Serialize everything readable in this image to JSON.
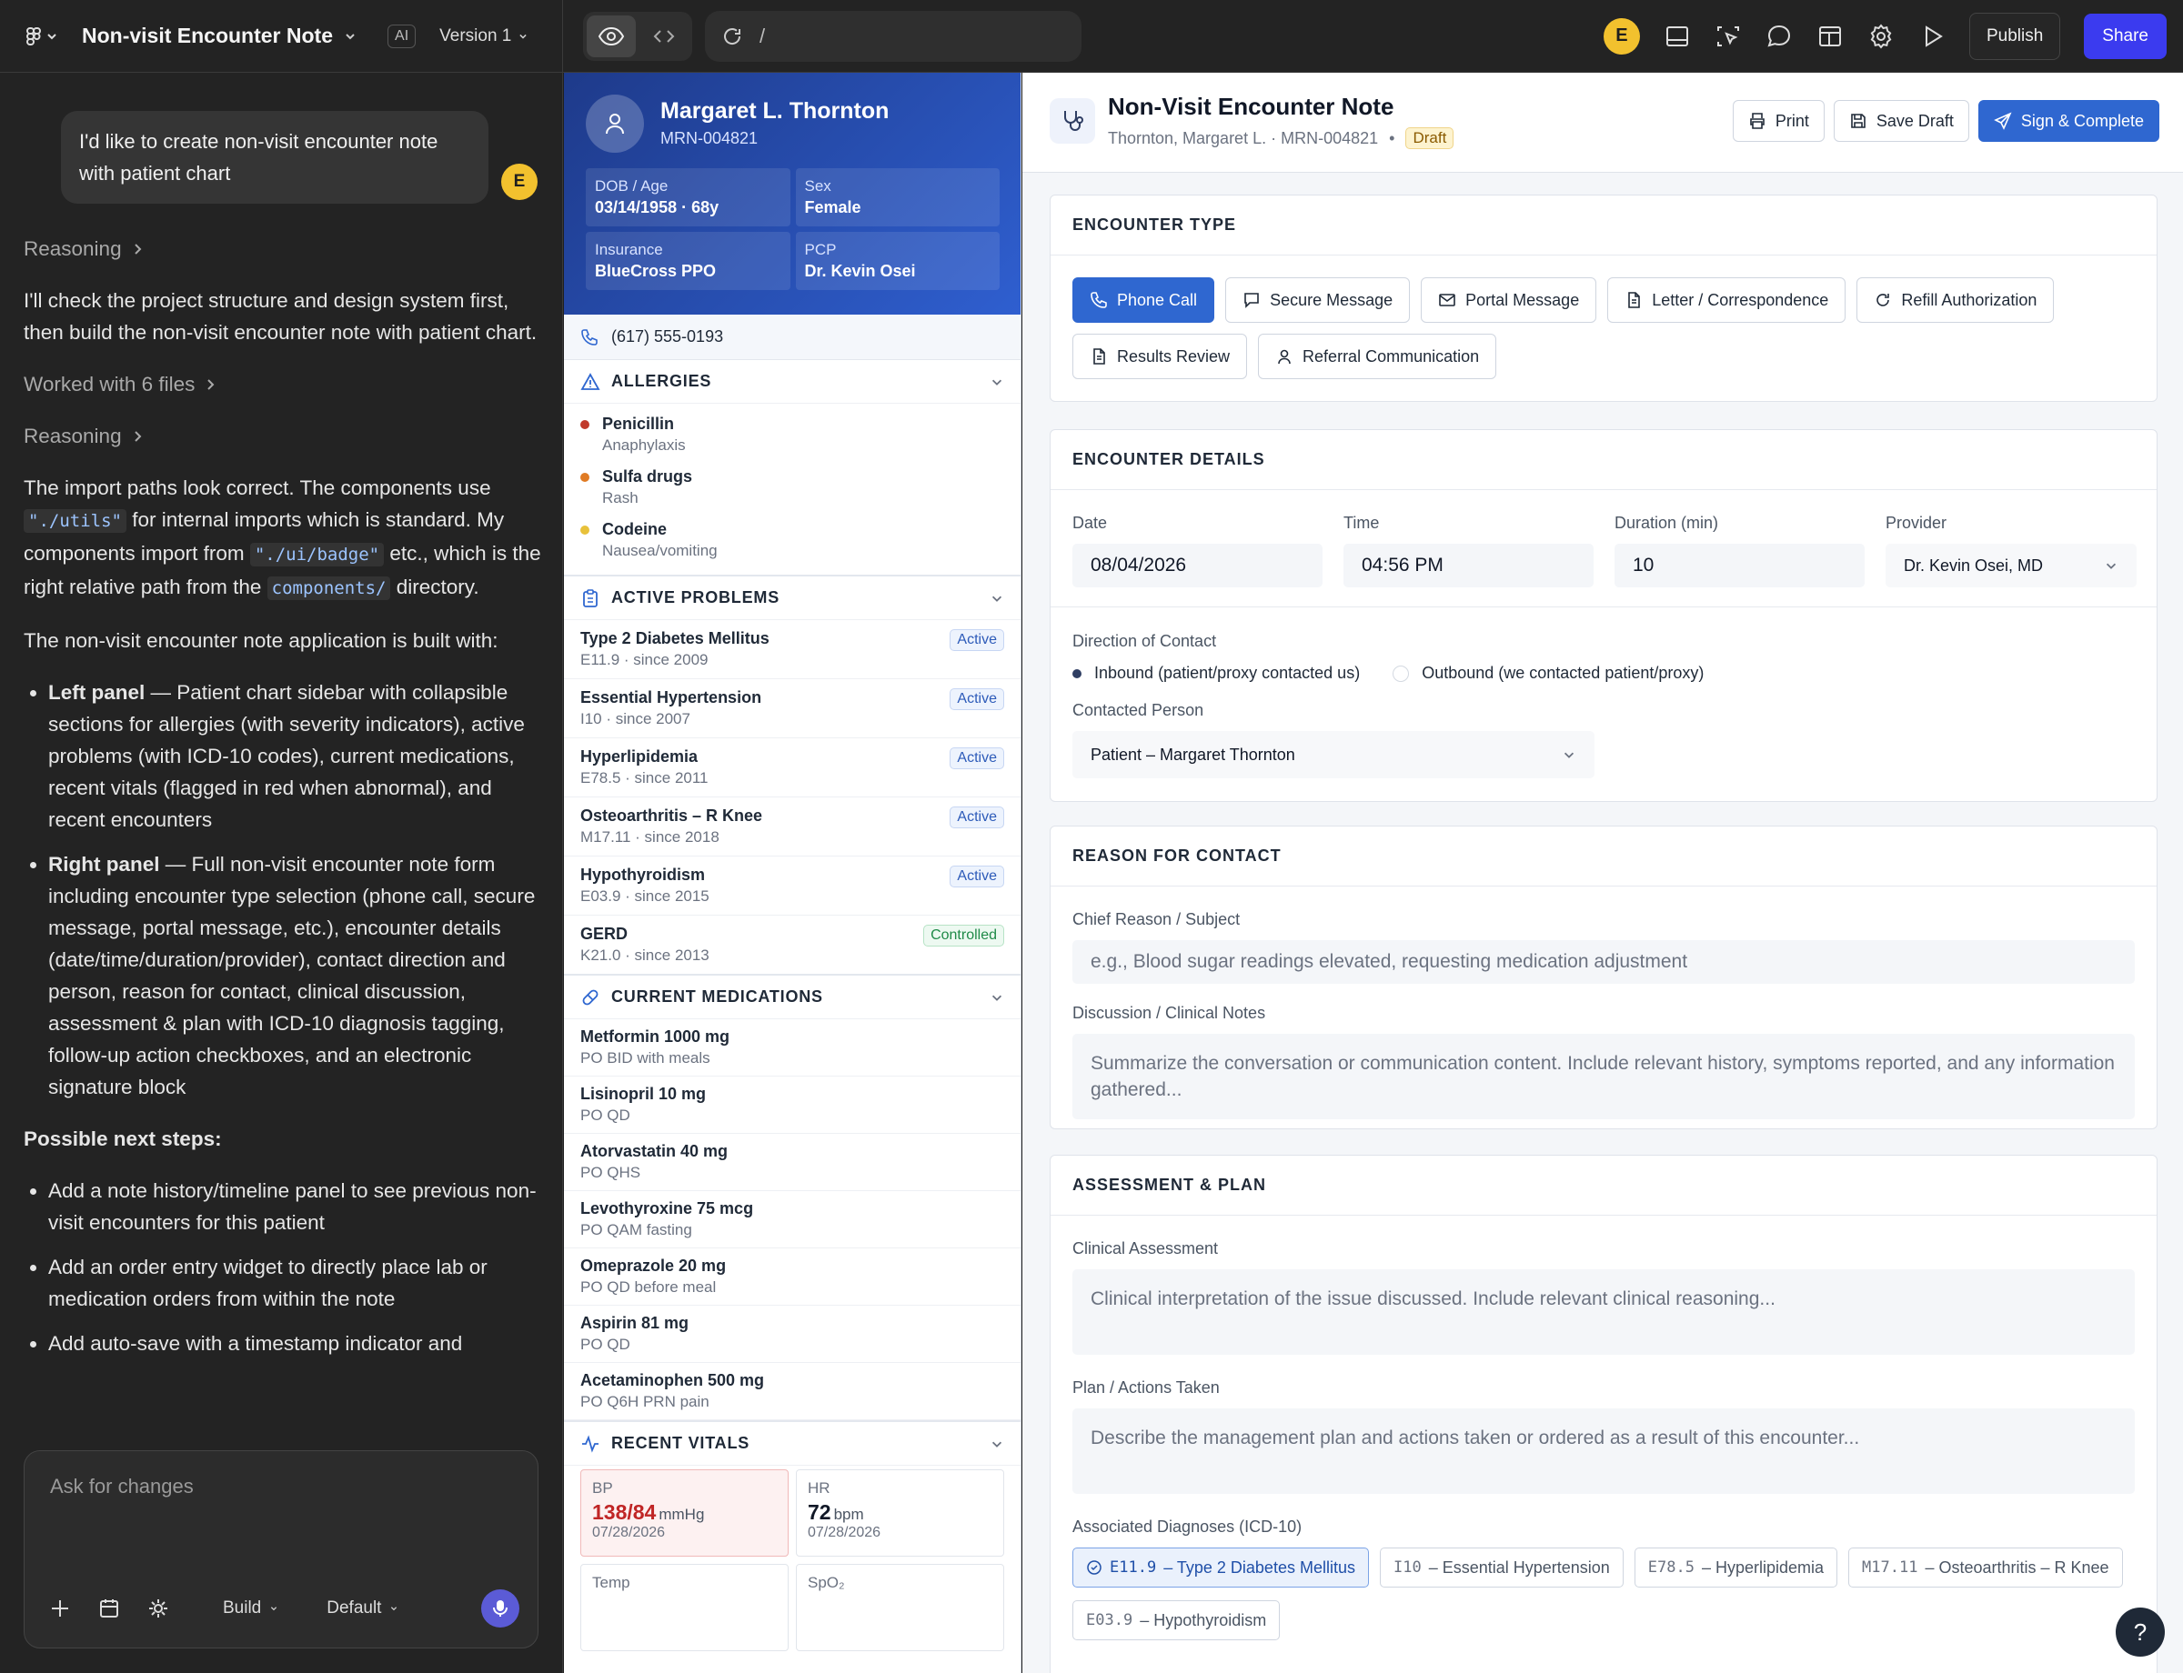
{
  "topbar": {
    "project_title": "Non-visit Encounter Note",
    "ai_badge": "AI",
    "version_label": "Version 1",
    "url_path": "/",
    "user_initial": "E",
    "publish_label": "Publish",
    "share_label": "Share"
  },
  "chat": {
    "user_message": "I'd like to create non-visit encounter note with patient chart",
    "user_initial": "E",
    "reasoning_1": "Reasoning",
    "para_1": "I'll check the project structure and design system first, then build the non-visit encounter note with patient chart.",
    "worked_files": "Worked with 6 files",
    "reasoning_2": "Reasoning",
    "para_2_a": "The import paths look correct. The components use ",
    "para_2_code1": "\"./utils\"",
    "para_2_b": " for internal imports which is standard. My components import from ",
    "para_2_code2": "\"./ui/badge\"",
    "para_2_c": " etc., which is the right relative path from the ",
    "para_2_code3": "components/",
    "para_2_d": " directory.",
    "para_3": "The non-visit encounter note application is built with:",
    "bullets": [
      {
        "bold": "Left panel",
        "text": " — Patient chart sidebar with collapsible sections for allergies (with severity indicators), active problems (with ICD-10 codes), current medications, recent vitals (flagged in red when abnormal), and recent encounters"
      },
      {
        "bold": "Right panel",
        "text": " — Full non-visit encounter note form including encounter type selection (phone call, secure message, portal message, etc.), encounter details (date/time/duration/provider), contact direction and person, reason for contact, clinical discussion, assessment & plan with ICD-10 diagnosis tagging, follow-up action checkboxes, and an electronic signature block"
      }
    ],
    "next_steps_title": "Possible next steps:",
    "next_steps": [
      "Add a note history/timeline panel to see previous non-visit encounters for this patient",
      "Add an order entry widget to directly place lab or medication orders from within the note",
      "Add auto-save with a timestamp indicator and"
    ],
    "composer_placeholder": "Ask for changes",
    "mode_label": "Build",
    "model_label": "Default"
  },
  "patient": {
    "name": "Margaret L. Thornton",
    "mrn": "MRN-004821",
    "dob_label": "DOB / Age",
    "dob_value": "03/14/1958 · 68y",
    "sex_label": "Sex",
    "sex_value": "Female",
    "insurance_label": "Insurance",
    "insurance_value": "BlueCross PPO",
    "pcp_label": "PCP",
    "pcp_value": "Dr. Kevin Osei",
    "phone": "(617) 555-0193"
  },
  "allergies": {
    "title": "ALLERGIES",
    "items": [
      {
        "name": "Penicillin",
        "reaction": "Anaphylaxis",
        "color": "#c0392b"
      },
      {
        "name": "Sulfa drugs",
        "reaction": "Rash",
        "color": "#e07b24"
      },
      {
        "name": "Codeine",
        "reaction": "Nausea/vomiting",
        "color": "#e8c13a"
      }
    ]
  },
  "problems": {
    "title": "ACTIVE PROBLEMS",
    "items": [
      {
        "name": "Type 2 Diabetes Mellitus",
        "detail": "E11.9 · since 2009",
        "status": "Active"
      },
      {
        "name": "Essential Hypertension",
        "detail": "I10 · since 2007",
        "status": "Active"
      },
      {
        "name": "Hyperlipidemia",
        "detail": "E78.5 · since 2011",
        "status": "Active"
      },
      {
        "name": "Osteoarthritis – R Knee",
        "detail": "M17.11 · since 2018",
        "status": "Active"
      },
      {
        "name": "Hypothyroidism",
        "detail": "E03.9 · since 2015",
        "status": "Active"
      },
      {
        "name": "GERD",
        "detail": "K21.0 · since 2013",
        "status": "Controlled"
      }
    ]
  },
  "medications": {
    "title": "CURRENT MEDICATIONS",
    "items": [
      {
        "name": "Metformin 1000 mg",
        "sig": "PO BID with meals"
      },
      {
        "name": "Lisinopril 10 mg",
        "sig": "PO QD"
      },
      {
        "name": "Atorvastatin 40 mg",
        "sig": "PO QHS"
      },
      {
        "name": "Levothyroxine 75 mcg",
        "sig": "PO QAM fasting"
      },
      {
        "name": "Omeprazole 20 mg",
        "sig": "PO QD before meal"
      },
      {
        "name": "Aspirin 81 mg",
        "sig": "PO QD"
      },
      {
        "name": "Acetaminophen 500 mg",
        "sig": "PO Q6H PRN pain"
      }
    ]
  },
  "vitals": {
    "title": "RECENT VITALS",
    "bp_label": "BP",
    "bp_value": "138/84",
    "bp_unit": "mmHg",
    "bp_date": "07/28/2026",
    "hr_label": "HR",
    "hr_value": "72",
    "hr_unit": "bpm",
    "hr_date": "07/28/2026",
    "temp_label": "Temp",
    "spo2_label": "SpO₂"
  },
  "note": {
    "title": "Non-Visit Encounter Note",
    "subtitle": "Thornton, Margaret L. · MRN-004821",
    "separator": "•",
    "status": "Draft",
    "print_label": "Print",
    "save_label": "Save Draft",
    "sign_label": "Sign & Complete"
  },
  "encounter_type": {
    "title": "ENCOUNTER TYPE",
    "types": [
      {
        "label": "Phone Call",
        "icon": "phone-icon"
      },
      {
        "label": "Secure Message",
        "icon": "message-icon"
      },
      {
        "label": "Portal Message",
        "icon": "mail-icon"
      },
      {
        "label": "Letter / Correspondence",
        "icon": "document-icon"
      },
      {
        "label": "Refill Authorization",
        "icon": "refresh-icon"
      },
      {
        "label": "Results Review",
        "icon": "document-icon"
      },
      {
        "label": "Referral Communication",
        "icon": "user-icon"
      }
    ],
    "selected": "Phone Call"
  },
  "details": {
    "title": "ENCOUNTER DETAILS",
    "date_label": "Date",
    "date_value": "08/04/2026",
    "time_label": "Time",
    "time_value": "04:56 PM",
    "duration_label": "Duration (min)",
    "duration_value": "10",
    "provider_label": "Provider",
    "provider_value": "Dr. Kevin Osei, MD",
    "direction_label": "Direction of Contact",
    "inbound_label": "Inbound (patient/proxy contacted us)",
    "outbound_label": "Outbound (we contacted patient/proxy)",
    "contacted_label": "Contacted Person",
    "contacted_value": "Patient – Margaret Thornton"
  },
  "reason": {
    "title": "REASON FOR CONTACT",
    "chief_label": "Chief Reason / Subject",
    "chief_placeholder": "e.g., Blood sugar readings elevated, requesting medication adjustment",
    "discussion_label": "Discussion / Clinical Notes",
    "discussion_placeholder": "Summarize the conversation or communication content. Include relevant history, symptoms reported, and any information gathered..."
  },
  "assessment": {
    "title": "ASSESSMENT & PLAN",
    "clinical_label": "Clinical Assessment",
    "clinical_placeholder": "Clinical interpretation of the issue discussed. Include relevant clinical reasoning...",
    "plan_label": "Plan / Actions Taken",
    "plan_placeholder": "Describe the management plan and actions taken or ordered as a result of this encounter...",
    "dx_label": "Associated Diagnoses (ICD-10)",
    "diagnoses": [
      {
        "code": "E11.9",
        "name": "– Type 2 Diabetes Mellitus",
        "selected": true
      },
      {
        "code": "I10",
        "name": "– Essential Hypertension",
        "selected": false
      },
      {
        "code": "E78.5",
        "name": "– Hyperlipidemia",
        "selected": false
      },
      {
        "code": "M17.11",
        "name": "– Osteoarthritis – R Knee",
        "selected": false
      },
      {
        "code": "E03.9",
        "name": "– Hypothyroidism",
        "selected": false
      }
    ]
  },
  "help_label": "?"
}
